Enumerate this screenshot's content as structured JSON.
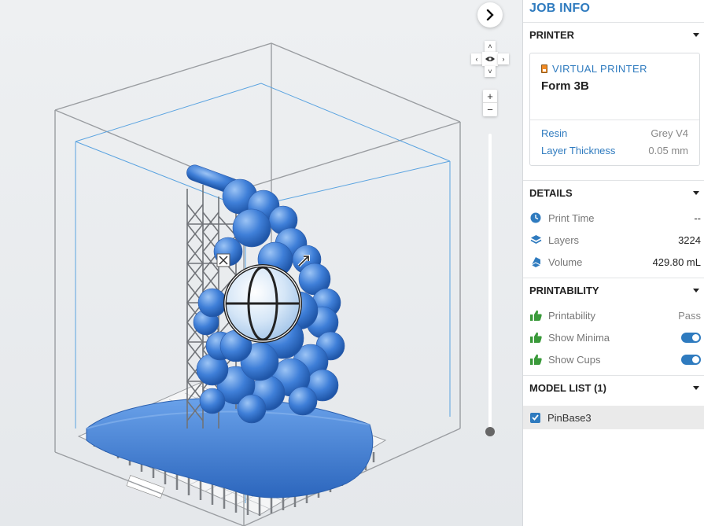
{
  "sidebar": {
    "title": "JOB INFO",
    "printer": {
      "heading": "PRINTER",
      "type_label": "VIRTUAL PRINTER",
      "name": "Form 3B",
      "resin_label": "Resin",
      "resin_value": "Grey V4",
      "layer_thickness_label": "Layer Thickness",
      "layer_thickness_value": "0.05 mm"
    },
    "details": {
      "heading": "DETAILS",
      "print_time_label": "Print Time",
      "print_time_value": "--",
      "layers_label": "Layers",
      "layers_value": "3224",
      "volume_label": "Volume",
      "volume_value": "429.80 mL"
    },
    "printability": {
      "heading": "PRINTABILITY",
      "printability_label": "Printability",
      "printability_value": "Pass",
      "show_minima_label": "Show Minima",
      "show_minima_on": true,
      "show_cups_label": "Show Cups",
      "show_cups_on": true
    },
    "model_list": {
      "heading": "MODEL LIST (1)",
      "items": [
        {
          "name": "PinBase3",
          "checked": true
        }
      ]
    }
  },
  "viewport": {
    "layer_slider_position": 1.0
  },
  "colors": {
    "accent": "#2f7bbf",
    "model": "#3f7fd8",
    "supports": "#8a8d91",
    "pass": "#3a9a3a"
  },
  "icons": [
    "chevron-right-icon",
    "eye-icon",
    "zoom-in-icon",
    "zoom-out-icon",
    "clock-icon",
    "layers-icon",
    "volume-icon",
    "thumbs-up-icon",
    "checkbox-icon",
    "printer-icon",
    "caret-down-icon",
    "rotate-handle-icon",
    "move-handle-icon",
    "scale-handle-icon"
  ]
}
